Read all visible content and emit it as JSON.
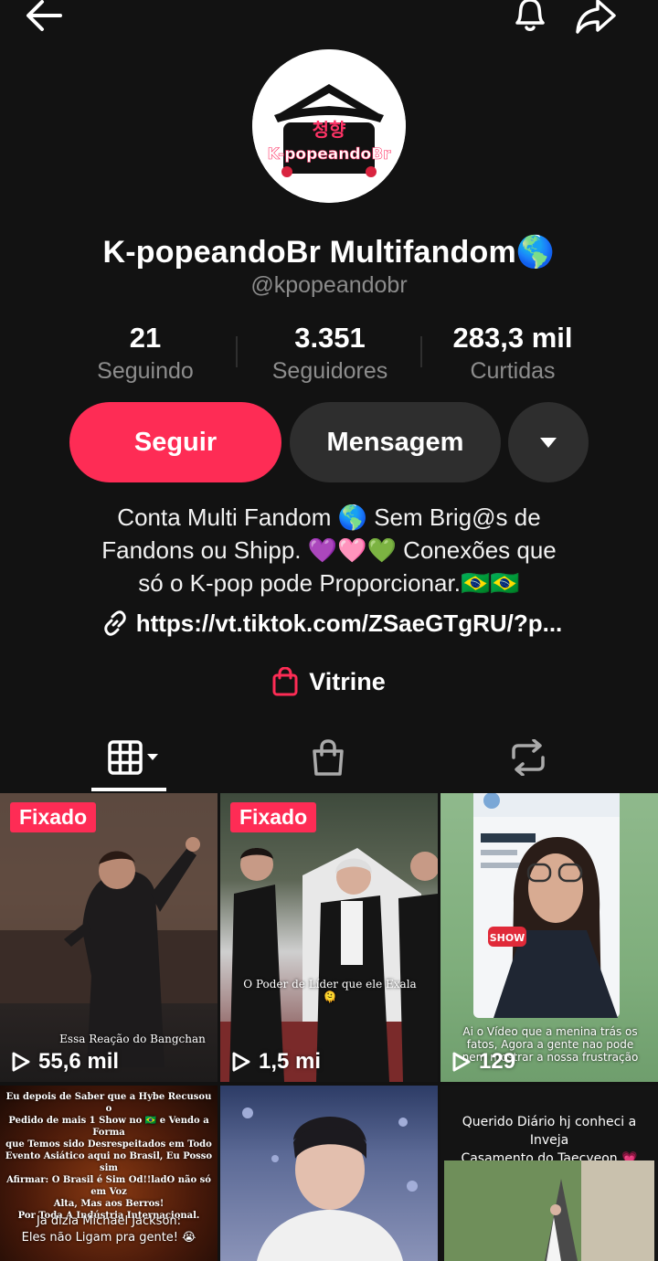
{
  "header": {
    "back_icon": "arrow-left-icon",
    "bell_icon": "bell-icon",
    "share_icon": "share-arrow-icon"
  },
  "avatar": {
    "logo_text_top": "청향",
    "logo_text_main": "K-popeandoBr"
  },
  "profile": {
    "name": "K-popeandoBr Multifandom🌎",
    "handle": "@kpopeandobr"
  },
  "stats": [
    {
      "value": "21",
      "label": "Seguindo"
    },
    {
      "value": "3.351",
      "label": "Seguidores"
    },
    {
      "value": "283,3 mil",
      "label": "Curtidas"
    }
  ],
  "actions": {
    "follow_label": "Seguir",
    "message_label": "Mensagem"
  },
  "bio": {
    "line1": "Conta Multi Fandom 🌎 Sem Brig@s de",
    "line2": "Fandons ou Shipp.  💜🩷💚 Conexões  que",
    "line3": "só  o K-pop  pode Proporcionar.🇧🇷🇧🇷",
    "link": "https://vt.tiktok.com/ZSaeGTgRU/?p..."
  },
  "vitrine_label": "Vitrine",
  "tabs": [
    "videos-grid-icon",
    "shop-bag-icon",
    "repost-icon"
  ],
  "colors": {
    "accent": "#fe2c55",
    "background": "#121212",
    "secondary_button": "#2e2e2e"
  },
  "videos": [
    {
      "pinned_label": "Fixado",
      "views": "55,6 mil",
      "caption": "Essa Reação do Bangchan"
    },
    {
      "pinned_label": "Fixado",
      "views": "1,5 mi",
      "caption": "O Poder de Líder que ele Exala 🫠"
    },
    {
      "views": "129",
      "caption": "Ai o Vídeo que a menina trás  os fatos, Agora a gente nao pode nem mostrar  a nossa frustração",
      "sticker": "SHOW"
    },
    {
      "caption_lines": [
        "Eu depois de Saber que a Hybe Recusou o",
        "Pedido de mais 1 Show no 🇧🇷 e Vendo a Forma",
        "que Temos sido Desrespeitados  em Todo",
        "Evento  Asiático aqui no Brasil, Eu Posso sim",
        "Afirmar:  O Brasil é  Sim Od!!ladO não  só  em Voz",
        "Alta, Mas aos Berros!",
        "Por Toda A Indústria Internacional."
      ],
      "caption2_lines": [
        "Ja dizia Michael Jackson:",
        "Eles não  Ligam pra gente! 😭"
      ]
    },
    {
      "caption": ""
    },
    {
      "caption_lines": [
        "Querido Diário hj conheci a Inveja",
        "Casamento do Taecyeon 💗"
      ]
    }
  ]
}
